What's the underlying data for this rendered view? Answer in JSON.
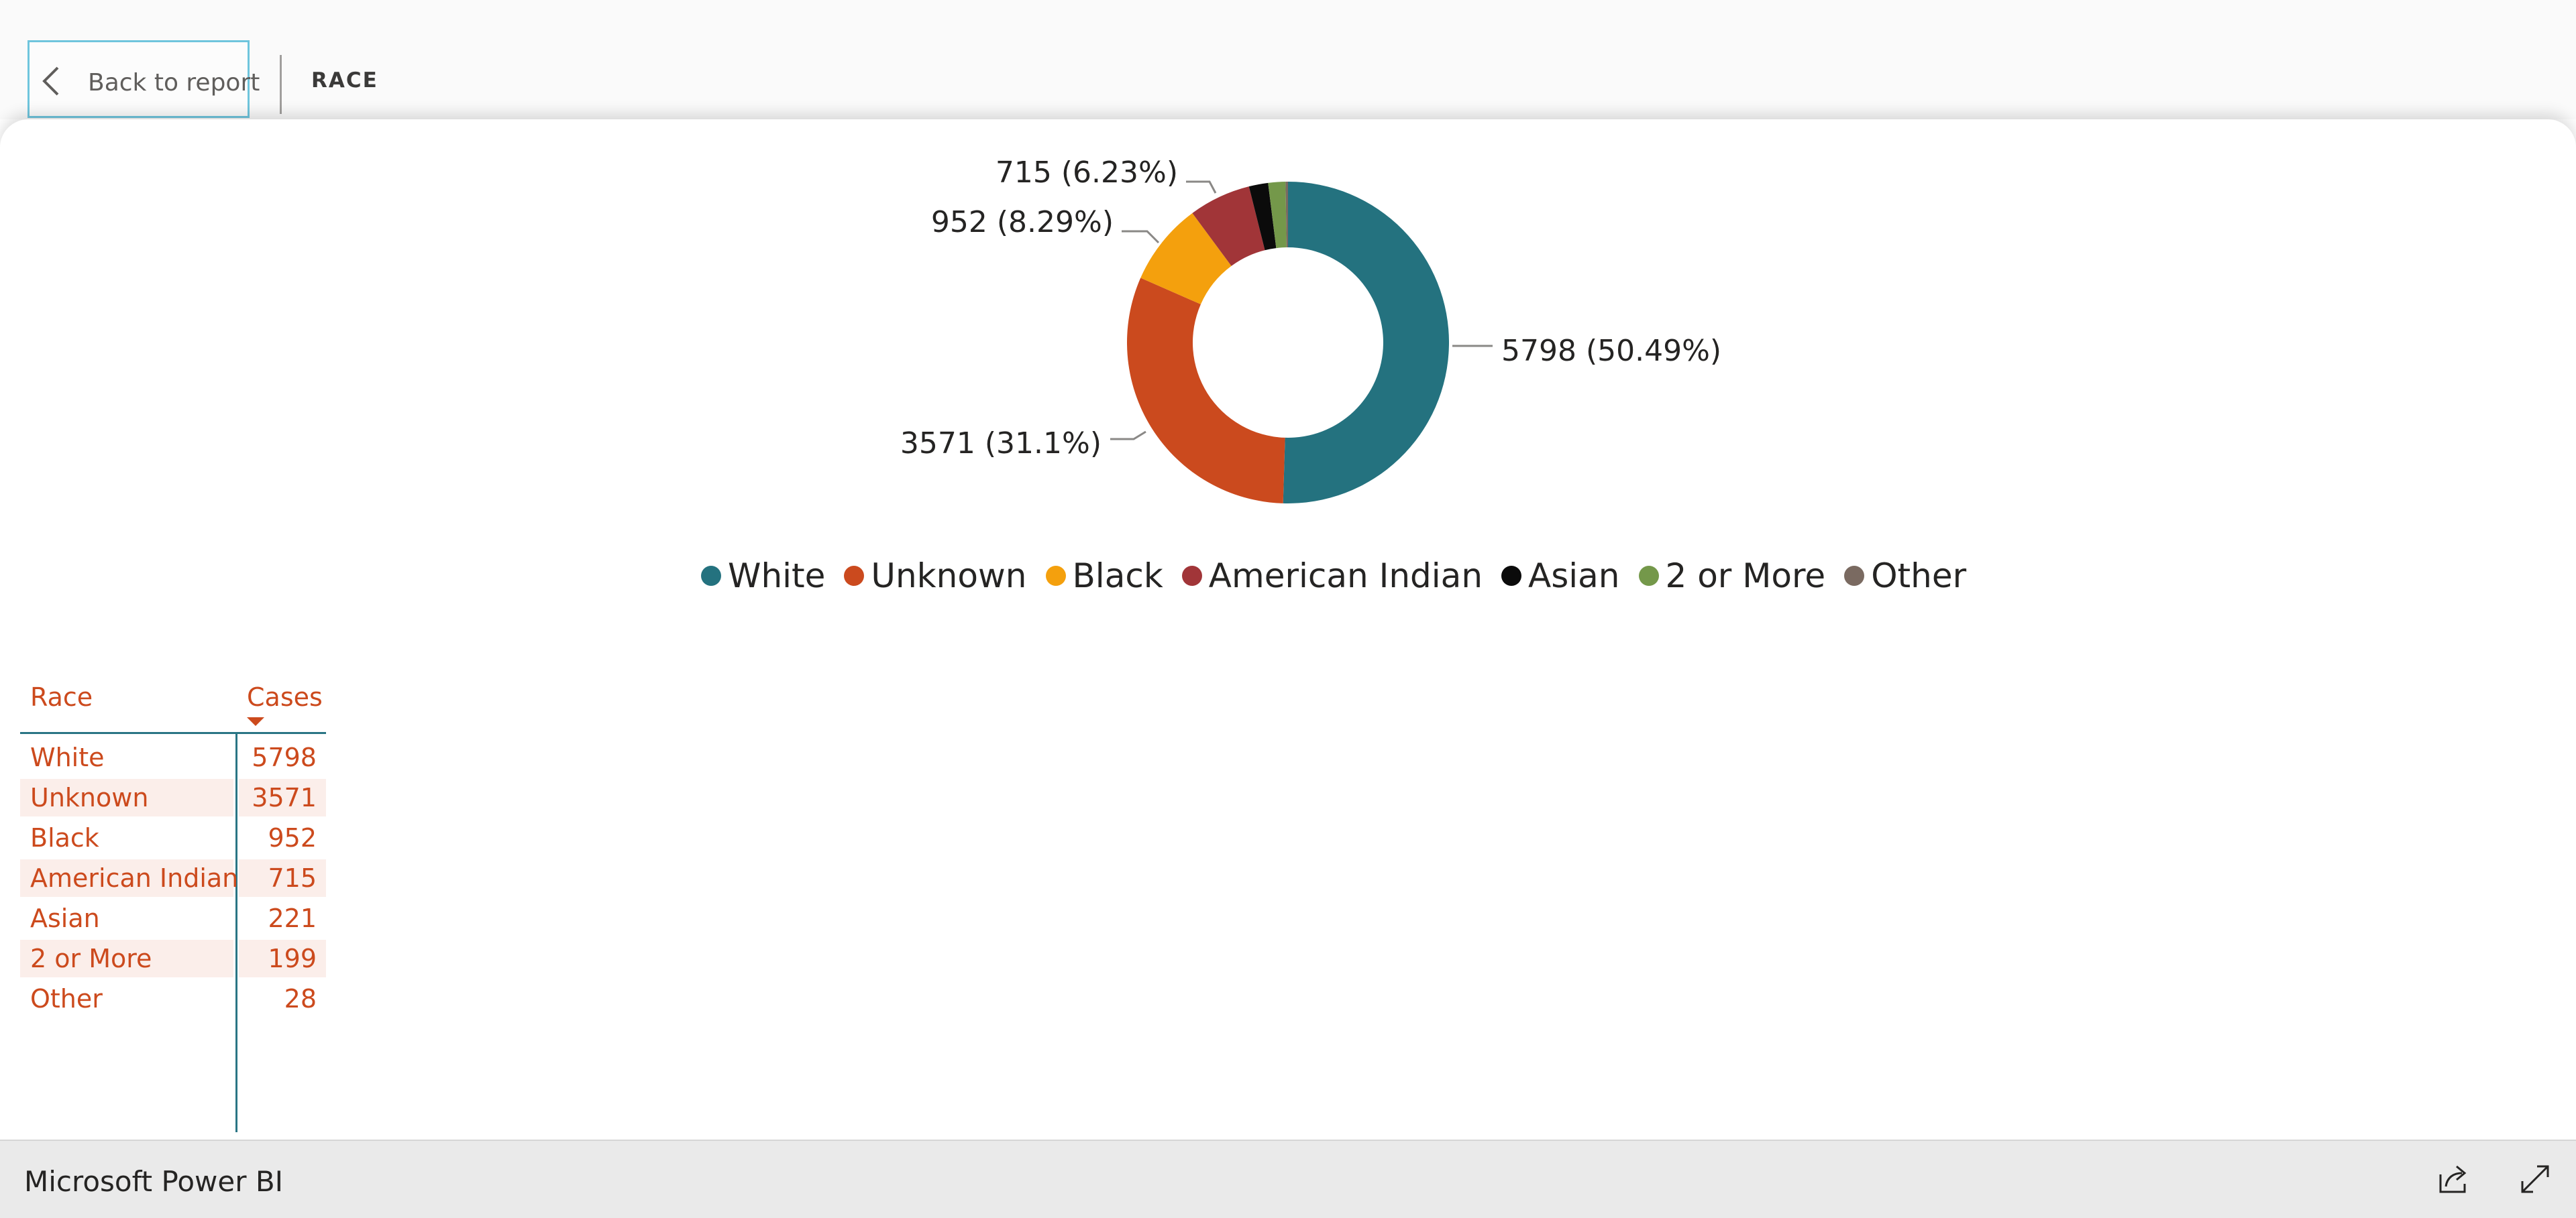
{
  "header": {
    "back_label": "Back to report",
    "page_title": "RACE"
  },
  "chart_data": {
    "type": "pie",
    "variant": "donut",
    "title": "",
    "categories": [
      "White",
      "Unknown",
      "Black",
      "American Indian",
      "Asian",
      "2 or More",
      "Other"
    ],
    "values": [
      5798,
      3571,
      952,
      715,
      221,
      199,
      28
    ],
    "colors": [
      "#24727f",
      "#cb4a1e",
      "#f4a00d",
      "#a13538",
      "#0b0b0b",
      "#74984a",
      "#7a6a61"
    ],
    "data_labels": [
      {
        "category": "White",
        "text": "5798 (50.49%)"
      },
      {
        "category": "Unknown",
        "text": "3571 (31.1%)"
      },
      {
        "category": "Black",
        "text": "952 (8.29%)"
      },
      {
        "category": "American Indian",
        "text": "715 (6.23%)"
      }
    ],
    "legend_position": "bottom"
  },
  "table": {
    "headers": {
      "race": "Race",
      "cases": "Cases"
    },
    "sort": "cases-descending",
    "rows": [
      {
        "race": "White",
        "cases": "5798"
      },
      {
        "race": "Unknown",
        "cases": "3571"
      },
      {
        "race": "Black",
        "cases": "952"
      },
      {
        "race": "American Indian",
        "cases": "715"
      },
      {
        "race": "Asian",
        "cases": "221"
      },
      {
        "race": "2 or More",
        "cases": "199"
      },
      {
        "race": "Other",
        "cases": "28"
      }
    ]
  },
  "footer": {
    "brand": "Microsoft Power BI",
    "icons": [
      "share-icon",
      "fullscreen-icon"
    ]
  },
  "colors": {
    "accent": "#cc4a1d",
    "table_line": "#2a7585",
    "back_button_border": "#6fc5dd"
  }
}
